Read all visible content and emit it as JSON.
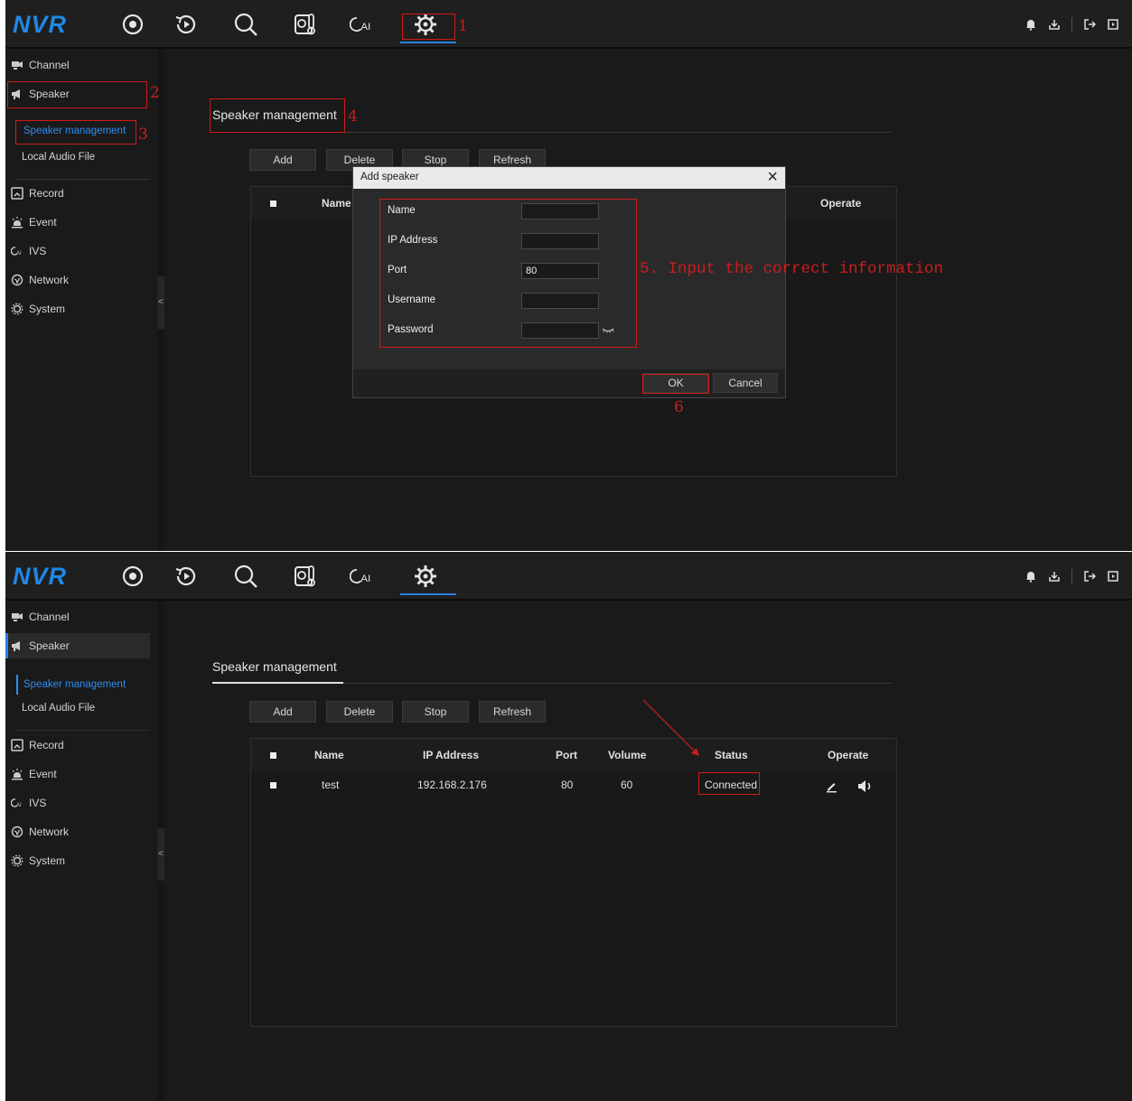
{
  "app": {
    "logo": "NVR",
    "nav_icons": [
      "live-view-icon",
      "playback-icon",
      "search-icon",
      "thermal-icon",
      "ai-icon",
      "settings-icon"
    ],
    "top_right_icons": [
      "bell-icon",
      "download-icon",
      "logout-icon",
      "exit-icon"
    ],
    "accent_color": "#2d7ee0"
  },
  "sidebar": {
    "items": [
      {
        "label": "Channel",
        "icon": "channel-icon"
      },
      {
        "label": "Speaker",
        "icon": "speaker-icon"
      },
      {
        "label": "Record",
        "icon": "record-icon"
      },
      {
        "label": "Event",
        "icon": "event-icon"
      },
      {
        "label": "IVS",
        "icon": "ivs-icon"
      },
      {
        "label": "Network",
        "icon": "network-icon"
      },
      {
        "label": "System",
        "icon": "system-icon"
      }
    ],
    "sub_items": [
      "Speaker management",
      "Local Audio File"
    ],
    "collapse_glyph": "<"
  },
  "content": {
    "title": "Speaker management",
    "buttons": {
      "add": "Add",
      "delete": "Delete",
      "stop": "Stop",
      "refresh": "Refresh"
    },
    "table": {
      "headers": {
        "name": "Name",
        "ip": "IP Address",
        "port": "Port",
        "volume": "Volume",
        "status": "Status",
        "operate": "Operate"
      },
      "rows": [
        {
          "name": "test",
          "ip": "192.168.2.176",
          "port": "80",
          "volume": "60",
          "status": "Connected"
        }
      ]
    }
  },
  "dialog": {
    "title": "Add speaker",
    "close_glyph": "×",
    "fields": [
      {
        "label": "Name",
        "value": ""
      },
      {
        "label": "IP Address",
        "value": ""
      },
      {
        "label": "Port",
        "value": "80"
      },
      {
        "label": "Username",
        "value": ""
      },
      {
        "label": "Password",
        "value": ""
      }
    ],
    "ok_label": "OK",
    "cancel_label": "Cancel"
  },
  "annotations": {
    "n1": "1",
    "n2": "2",
    "n3": "3",
    "n4": "4",
    "n5": "5. Input the correct information",
    "n6": "6",
    "annotation_color": "#c81e1e"
  }
}
